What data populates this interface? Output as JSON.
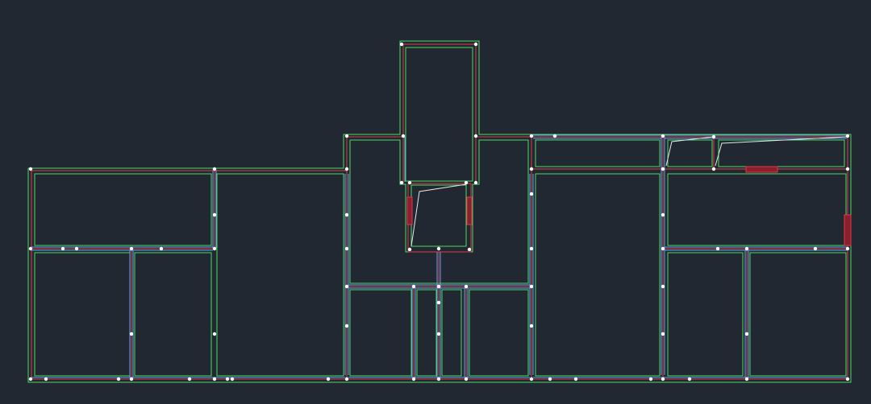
{
  "app": {
    "view": "cad-floor-plan-canvas"
  },
  "colors": {
    "background": "#222831",
    "wall_outer": "#4cd964",
    "wall_centerline": "#e0374a",
    "wall_inner": "#5aa9f0",
    "door_swing": "#e6e6e6",
    "node": "#ffffff",
    "window_fill": "#8a1f2e",
    "window_stroke": "#e0374a"
  },
  "layers": [
    {
      "name": "outer-wall-line",
      "color": "#4cd964"
    },
    {
      "name": "wall-centerline",
      "color": "#e0374a"
    },
    {
      "name": "inner-partition-line",
      "color": "#5aa9f0"
    },
    {
      "name": "door-swing-line",
      "color": "#e6e6e6"
    },
    {
      "name": "vertex-node",
      "color": "#ffffff"
    },
    {
      "name": "window-opening",
      "color": "#8a1f2e"
    }
  ]
}
